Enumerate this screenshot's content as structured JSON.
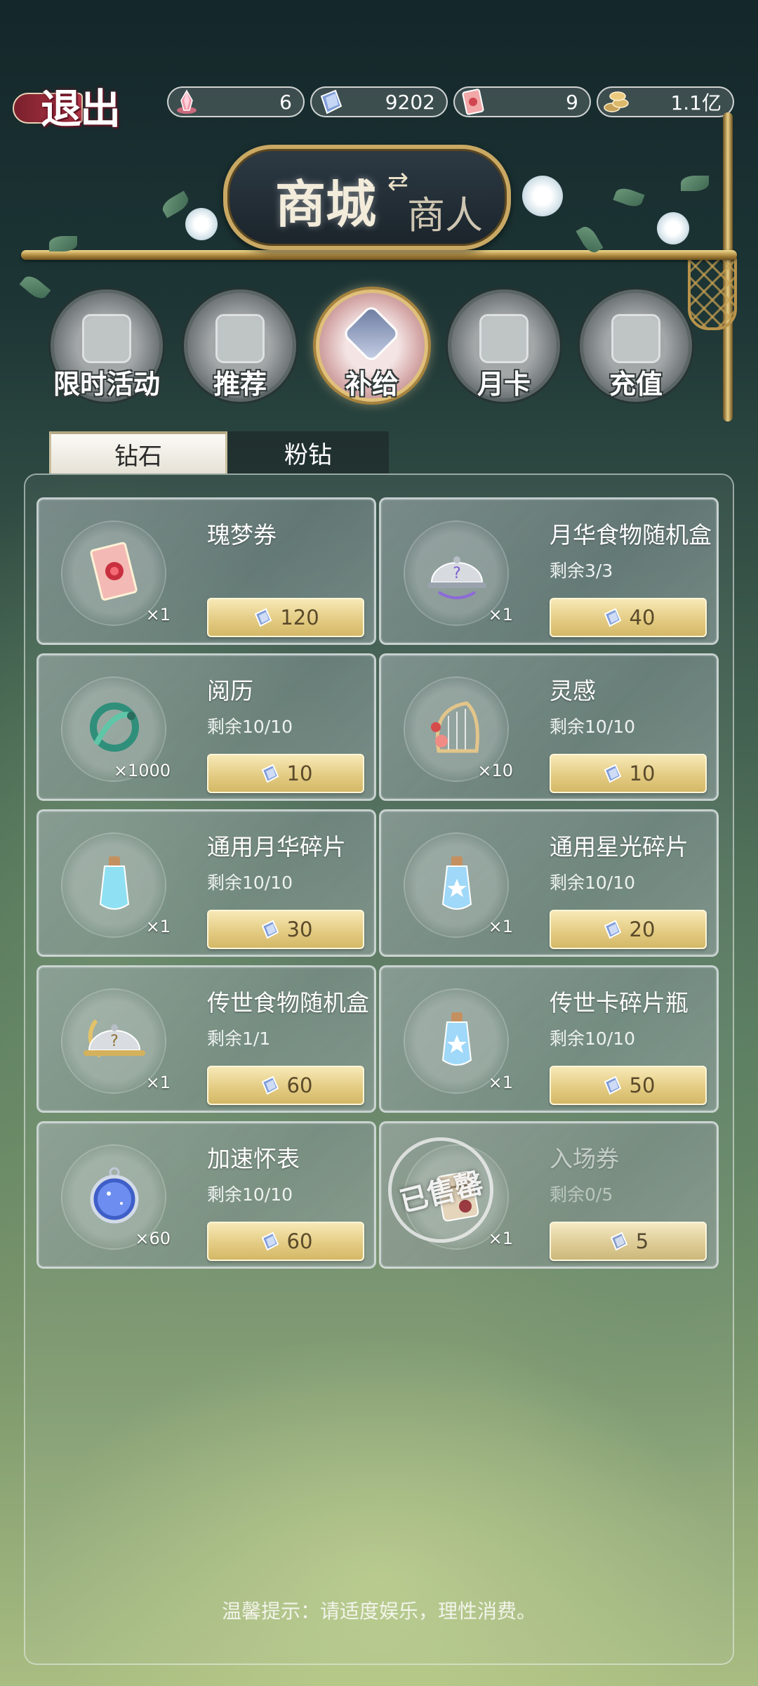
{
  "header": {
    "exit_label": "退出",
    "currencies": [
      {
        "icon": "pink-crystal-icon",
        "value": "6"
      },
      {
        "icon": "blue-diamond-icon",
        "value": "9202"
      },
      {
        "icon": "pink-ticket-icon",
        "value": "9"
      },
      {
        "icon": "gold-coin-icon",
        "value": "1.1亿"
      }
    ]
  },
  "sign": {
    "main": "商城",
    "arrow": "⇄",
    "sub": "商人"
  },
  "categories": [
    {
      "label": "限时活动",
      "active": false
    },
    {
      "label": "推荐",
      "active": false
    },
    {
      "label": "补给",
      "active": true
    },
    {
      "label": "月卡",
      "active": false
    },
    {
      "label": "充值",
      "active": false
    }
  ],
  "tabs": [
    {
      "label": "钻石",
      "active": true
    },
    {
      "label": "粉钻",
      "active": false
    }
  ],
  "items": [
    {
      "name": "瑰梦券",
      "remain": "",
      "qty": "×1",
      "price": "120",
      "icon": "rose-ticket-icon",
      "sold_out": false
    },
    {
      "name": "月华食物随机盒",
      "remain": "剩余3/3",
      "qty": "×1",
      "price": "40",
      "icon": "silver-cloche-icon",
      "sold_out": false
    },
    {
      "name": "阅历",
      "remain": "剩余10/10",
      "qty": "×1000",
      "price": "10",
      "icon": "serpent-emblem-icon",
      "sold_out": false
    },
    {
      "name": "灵感",
      "remain": "剩余10/10",
      "qty": "×10",
      "price": "10",
      "icon": "harp-flower-icon",
      "sold_out": false
    },
    {
      "name": "通用月华碎片",
      "remain": "剩余10/10",
      "qty": "×1",
      "price": "30",
      "icon": "moon-potion-icon",
      "sold_out": false
    },
    {
      "name": "通用星光碎片",
      "remain": "剩余10/10",
      "qty": "×1",
      "price": "20",
      "icon": "star-potion-icon",
      "sold_out": false
    },
    {
      "name": "传世食物随机盒",
      "remain": "剩余1/1",
      "qty": "×1",
      "price": "60",
      "icon": "gold-cloche-icon",
      "sold_out": false
    },
    {
      "name": "传世卡碎片瓶",
      "remain": "剩余10/10",
      "qty": "×1",
      "price": "50",
      "icon": "gold-moon-potion-icon",
      "sold_out": false
    },
    {
      "name": "加速怀表",
      "remain": "剩余10/10",
      "qty": "×60",
      "price": "60",
      "icon": "pocket-watch-icon",
      "sold_out": false
    },
    {
      "name": "入场券",
      "remain": "剩余0/5",
      "qty": "×1",
      "price": "5",
      "icon": "scroll-ticket-icon",
      "sold_out": true,
      "stamp": "已售罄"
    }
  ],
  "footer": {
    "tip": "温馨提示：请适度娱乐，理性消费。"
  },
  "colors": {
    "price_gold": "#e4cc84",
    "accent_gold": "#c9a863",
    "diamond_blue": "#7f9dd8"
  }
}
